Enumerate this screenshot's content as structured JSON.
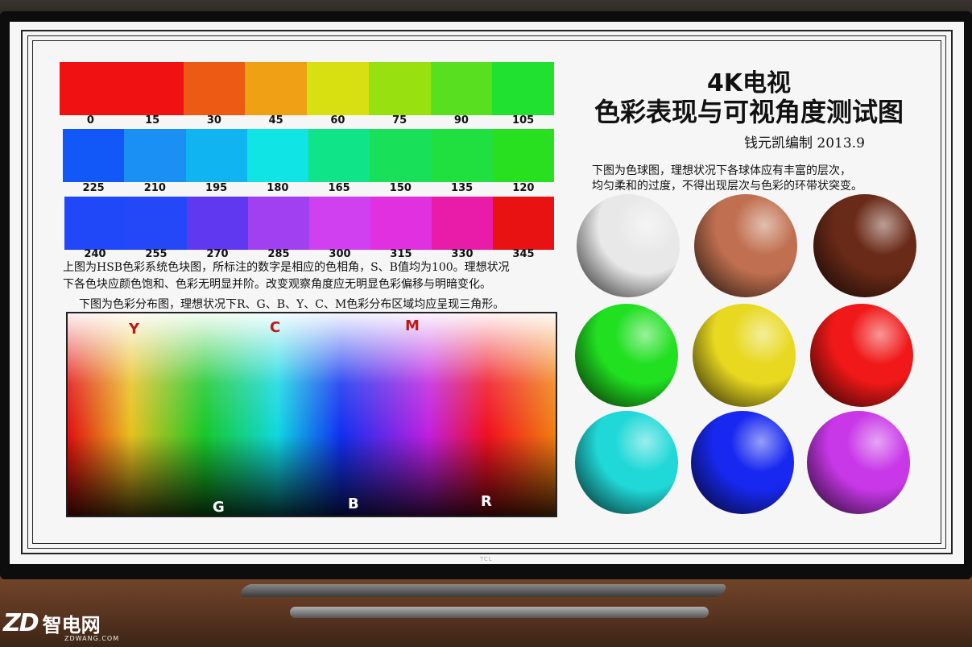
{
  "strips": [
    {
      "labels": [
        "0",
        "15",
        "30",
        "45",
        "60",
        "75",
        "90",
        "105"
      ],
      "colors": [
        "#f01212",
        "#f01212",
        "#ec5a14",
        "#f0a014",
        "#d8e012",
        "#98e010",
        "#58e020",
        "#20e030"
      ]
    },
    {
      "labels": [
        "225",
        "210",
        "195",
        "180",
        "165",
        "150",
        "135",
        "120"
      ],
      "colors": [
        "#1258f8",
        "#1a90f4",
        "#10b4f0",
        "#10e4e4",
        "#10e488",
        "#18e058",
        "#20e040",
        "#28e020"
      ]
    },
    {
      "labels": [
        "240",
        "255",
        "270",
        "285",
        "300",
        "315",
        "330",
        "345"
      ],
      "colors": [
        "#2048f8",
        "#2448f8",
        "#6038f0",
        "#a040f0",
        "#d040f0",
        "#e030e0",
        "#e81ca8",
        "#e81212"
      ]
    }
  ],
  "hsb_text": [
    "上图为HSB色彩系统色块图，所标注的数字是相应的色相角，S、B值均为100。理想状况",
    "下各色块应颜色饱和、色彩无明显并阶。改变观察角度应无明显色彩偏移与明暗变化。"
  ],
  "dist_text": "下图为色彩分布图，理想状况下R、G、B、Y、C、M色彩分布区域均应呈现三角形。",
  "triangle_labels": {
    "Y": "Y",
    "C": "C",
    "M": "M",
    "G": "G",
    "B": "B",
    "R": "R"
  },
  "title_line1": "4K电视",
  "title_line2": "色彩表现与可视角度测试图",
  "author": "钱元凯编制 2013.9",
  "sphere_text": [
    "下图为色球图，理想状况下各球体应有丰富的层次，",
    "均匀柔和的过度，不得出现层次与色彩的环带状突变。"
  ],
  "spheres": [
    {
      "name": "white-sphere",
      "color": "#e8e8e8"
    },
    {
      "name": "skin-sphere",
      "color": "#c07050"
    },
    {
      "name": "brown-sphere",
      "color": "#6a2a18"
    },
    {
      "name": "green-sphere",
      "color": "#20e020"
    },
    {
      "name": "yellow-sphere",
      "color": "#e8d820"
    },
    {
      "name": "red-sphere",
      "color": "#f01818"
    },
    {
      "name": "cyan-sphere",
      "color": "#20d8d8"
    },
    {
      "name": "blue-sphere",
      "color": "#1828f0"
    },
    {
      "name": "purple-sphere",
      "color": "#c838e8"
    }
  ],
  "tv_brand": "TCL",
  "watermark": {
    "logo": "ZD",
    "name": "智电网",
    "url": "ZDWANG.COM"
  }
}
